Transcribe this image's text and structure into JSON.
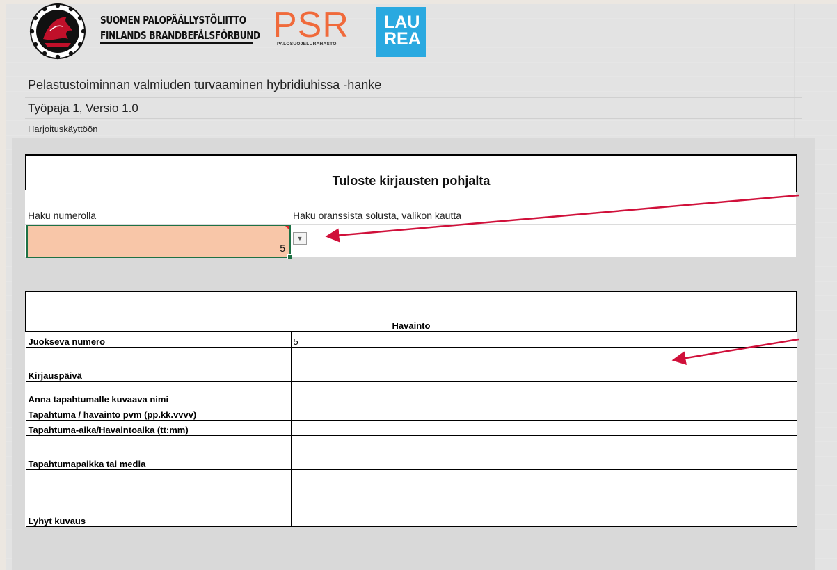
{
  "header": {
    "org_line1": "SUOMEN PALOPÄÄLLYSTÖLIITTO",
    "org_line2": "FINLANDS BRANDBEFÄLSFÖRBUND",
    "psr_logo": "PSR",
    "psr_sub": "PALOSUOJELURAHASTO",
    "laurea_line1": "LAU",
    "laurea_line2": "REA",
    "title": "Pelastustoiminnan valmiuden turvaaminen hybridiuhissa -hanke",
    "subtitle": "Työpaja 1, Versio 1.0",
    "subtitle2": "Harjoituskäyttöön"
  },
  "search": {
    "title": "Tuloste kirjausten pohjalta",
    "label_number": "Haku numerolla",
    "label_dropdown": "Haku oranssista solusta, valikon kautta",
    "input_value": "5",
    "dropdown_icon": "chevron-down-icon"
  },
  "table": {
    "header": "Havainto",
    "rows": [
      {
        "label": "Juokseva numero",
        "value": "5"
      },
      {
        "label": "Kirjauspäivä",
        "value": ""
      },
      {
        "label": "Anna tapahtumalle kuvaava nimi",
        "value": ""
      },
      {
        "label": "Tapahtuma / havainto pvm (pp.kk.vvvv)",
        "value": ""
      },
      {
        "label": "Tapahtuma-aika/Havaintoaika (tt:mm)",
        "value": ""
      },
      {
        "label": "Tapahtumapaikka tai media",
        "value": ""
      },
      {
        "label": "Lyhyt kuvaus",
        "value": ""
      }
    ]
  },
  "colors": {
    "input_fill": "#f8c6a8",
    "selection_border": "#1e7145",
    "arrow": "#d0103a",
    "gray_area": "#d9d9d9"
  }
}
